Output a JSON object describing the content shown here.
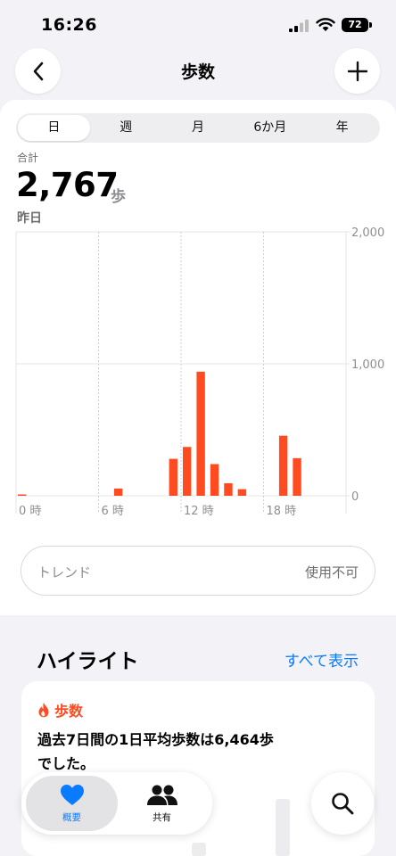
{
  "status_bar": {
    "time": "16:26",
    "battery": "72"
  },
  "nav": {
    "title": "歩数"
  },
  "segments": [
    "日",
    "週",
    "月",
    "6か月",
    "年"
  ],
  "summary": {
    "total_label": "合計",
    "total_value": "2,767",
    "unit": "歩",
    "date": "昨日"
  },
  "chart_data": {
    "type": "bar",
    "x_tick_labels": [
      "0 時",
      "6 時",
      "12 時",
      "18 時"
    ],
    "y_tick_labels": [
      "2,000",
      "1,000",
      "0"
    ],
    "ylim": [
      0,
      2000
    ],
    "hours": [
      0,
      1,
      2,
      3,
      4,
      5,
      6,
      7,
      8,
      9,
      10,
      11,
      12,
      13,
      14,
      15,
      16,
      17,
      18,
      19,
      20,
      21,
      22,
      23
    ],
    "values": [
      10,
      0,
      0,
      0,
      0,
      0,
      0,
      55,
      0,
      0,
      0,
      280,
      370,
      940,
      240,
      95,
      50,
      0,
      0,
      455,
      285,
      0,
      0,
      0
    ],
    "bar_color": "#ff4b1f",
    "grid": true
  },
  "trend": {
    "label": "トレンド",
    "value": "使用不可"
  },
  "highlights": {
    "title": "ハイライト",
    "show_all": "すべて表示",
    "card": {
      "icon": "flame-icon",
      "label": "歩数",
      "line1": "過去7日間の1日平均歩数は6,464歩",
      "line2": "でした。"
    }
  },
  "tab_bar": {
    "summary_label": "概要",
    "sharing_label": "共有"
  },
  "colors": {
    "accent": "#0a7aff",
    "steps": "#ff4b1f"
  }
}
